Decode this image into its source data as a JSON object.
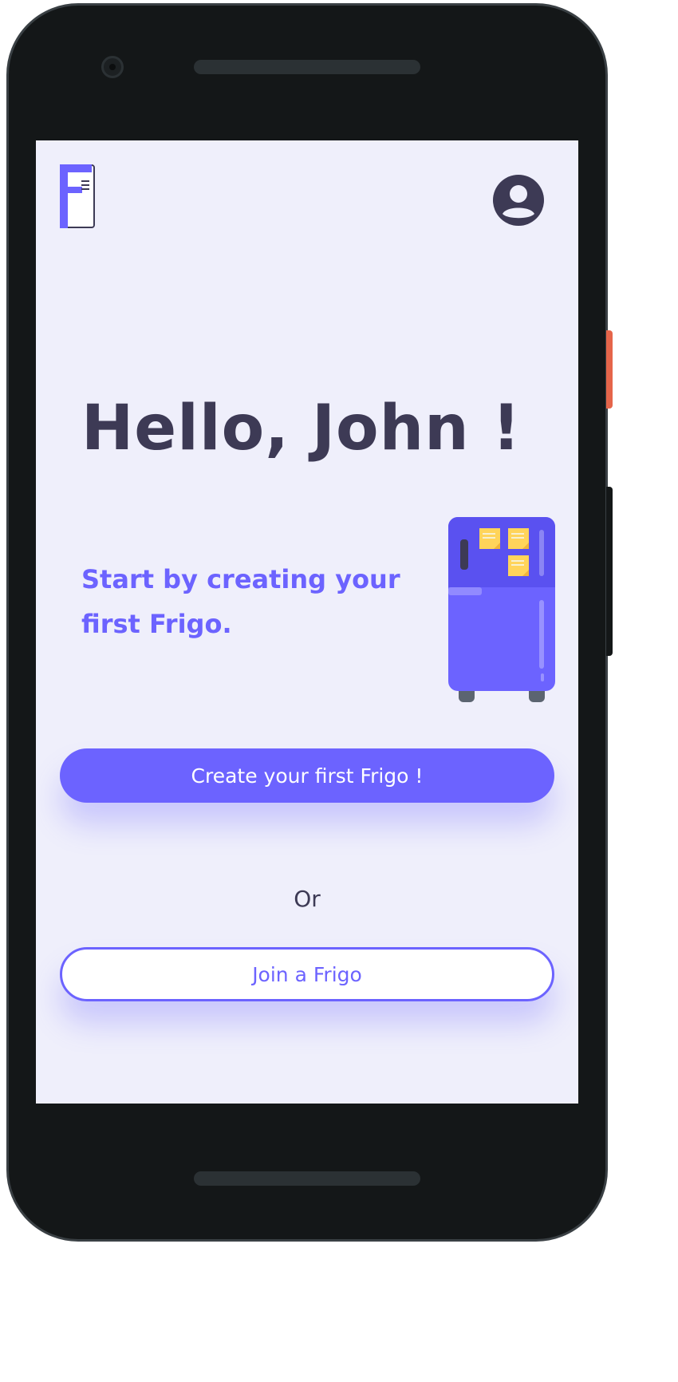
{
  "colors": {
    "accent": "#6c63ff",
    "text_dark": "#3d3a55",
    "screen_background": "#efeffb",
    "device_frame": "#141718",
    "note_yellow": "#ffd45a"
  },
  "header": {
    "logo_icon": "fridge-logo-icon",
    "profile_icon": "account-circle-icon"
  },
  "main": {
    "greeting": "Hello, John !",
    "subtitle": "Start by creating your first Frigo.",
    "illustration": "fridge-illustration",
    "create_button_label": "Create your first Frigo !",
    "or_label": "Or",
    "join_button_label": "Join a Frigo"
  }
}
